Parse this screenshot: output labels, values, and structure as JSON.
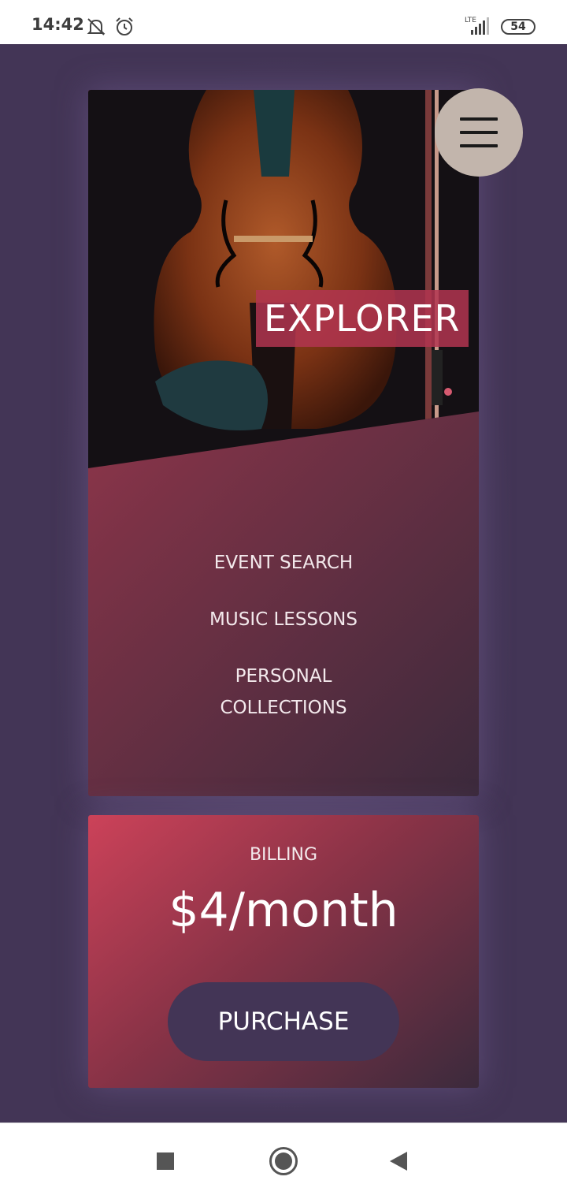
{
  "status_bar": {
    "time": "14:42",
    "network": "LTE",
    "battery": "54",
    "icons": [
      "mute-bell-icon",
      "alarm-icon",
      "signal-icon",
      "battery-icon"
    ]
  },
  "hero": {
    "title": "EXPLORER",
    "menu_icon": "hamburger-menu-icon",
    "image": "violin-photo"
  },
  "menu": {
    "items": [
      {
        "label": "EVENT SEARCH"
      },
      {
        "label": "MUSIC LESSONS"
      },
      {
        "label_line1": "PERSONAL",
        "label_line2": "COLLECTIONS"
      }
    ]
  },
  "billing": {
    "label": "BILLING",
    "price": "$4/month",
    "button": "PURCHASE"
  },
  "colors": {
    "background": "#433556",
    "accent": "#b23b52",
    "menu_button": "#c2b5ac"
  },
  "nav_bar": {
    "icons": [
      "recent-apps-icon",
      "home-icon",
      "back-icon"
    ]
  }
}
